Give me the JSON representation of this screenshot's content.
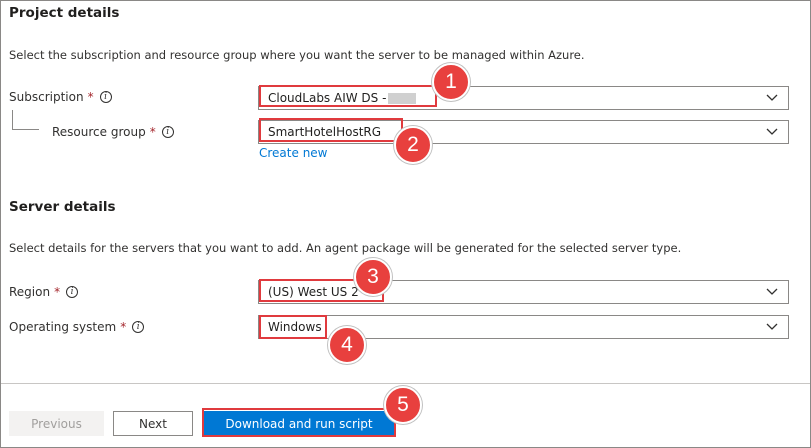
{
  "project": {
    "heading": "Project details",
    "description": "Select the subscription and resource group where you want the server to be managed within Azure.",
    "subscription": {
      "label": "Subscription",
      "required": "*",
      "value": "CloudLabs AIW DS -"
    },
    "resource_group": {
      "label": "Resource group",
      "required": "*",
      "value": "SmartHotelHostRG",
      "create_link": "Create new"
    }
  },
  "server": {
    "heading": "Server details",
    "description": "Select details for the servers that you want to add. An agent package will be generated for the selected server type.",
    "region": {
      "label": "Region",
      "required": "*",
      "value": "(US) West US 2"
    },
    "os": {
      "label": "Operating system",
      "required": "*",
      "value": "Windows"
    }
  },
  "info_glyph": "i",
  "footer": {
    "previous_label": "Previous",
    "next_label": "Next",
    "download_label": "Download and run script"
  },
  "callouts": [
    "1",
    "2",
    "3",
    "4",
    "5"
  ],
  "colors": {
    "accent": "#0078d4",
    "callout": "#e8403e",
    "required": "#a4262c"
  }
}
